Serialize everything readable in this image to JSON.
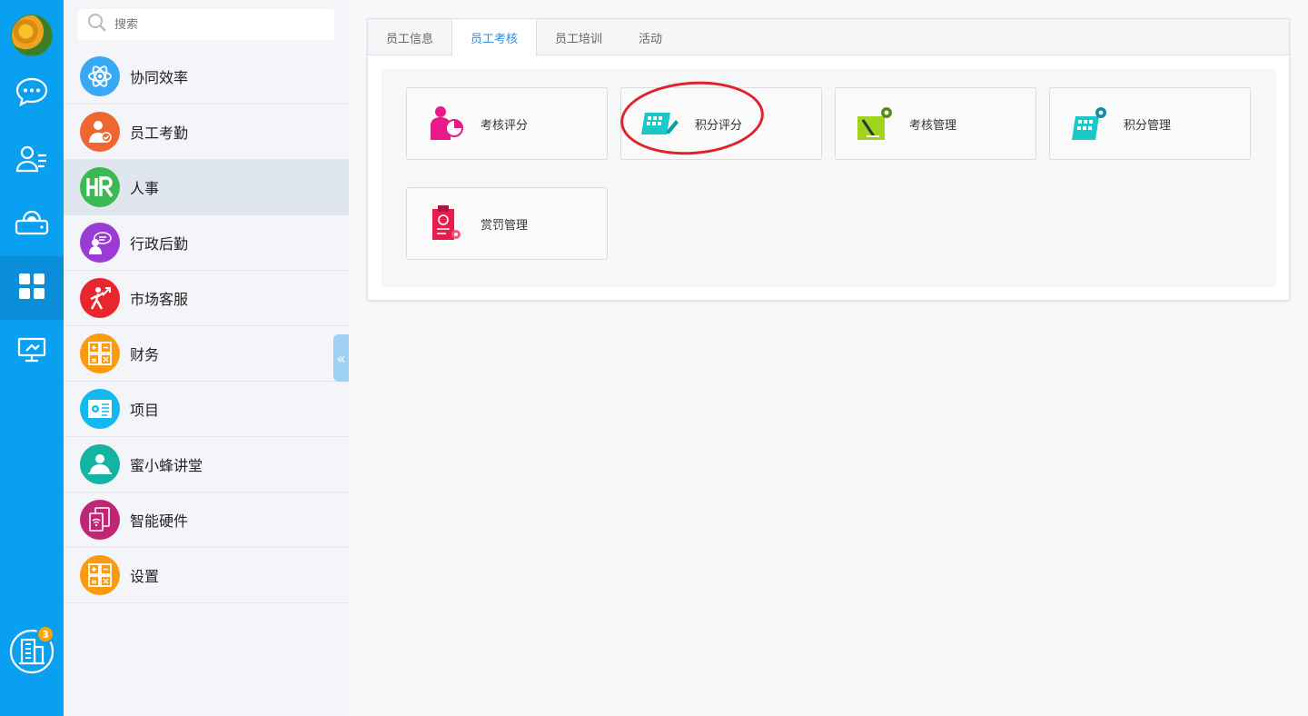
{
  "search": {
    "placeholder": "搜索"
  },
  "rail": {
    "badge_count": "3"
  },
  "sidebar": {
    "items": [
      {
        "label": "协同效率",
        "color": "#3aa9f5"
      },
      {
        "label": "员工考勤",
        "color": "#ee6733"
      },
      {
        "label": "人事",
        "color": "#3cb954"
      },
      {
        "label": "行政后勤",
        "color": "#9b3bd6"
      },
      {
        "label": "市场客服",
        "color": "#e8262e"
      },
      {
        "label": "财务",
        "color": "#fb9a0f"
      },
      {
        "label": "项目",
        "color": "#13b8ef"
      },
      {
        "label": "蜜小蜂讲堂",
        "color": "#15b3a2"
      },
      {
        "label": "智能硬件",
        "color": "#c12676"
      },
      {
        "label": "设置",
        "color": "#fb9a0f"
      }
    ]
  },
  "tabs": [
    {
      "label": "员工信息"
    },
    {
      "label": "员工考核"
    },
    {
      "label": "员工培训"
    },
    {
      "label": "活动"
    }
  ],
  "cards": [
    {
      "label": "考核评分",
      "icon": "person-chart-icon"
    },
    {
      "label": "积分评分",
      "icon": "grid-pen-icon"
    },
    {
      "label": "考核管理",
      "icon": "checklist-gear-icon"
    },
    {
      "label": "积分管理",
      "icon": "grid-gear-icon"
    },
    {
      "label": "赏罚管理",
      "icon": "clipboard-award-icon"
    }
  ],
  "colors": {
    "accent": "#0aa0f2",
    "tab_active": "#2f8de4",
    "highlight": "#e0222b"
  }
}
